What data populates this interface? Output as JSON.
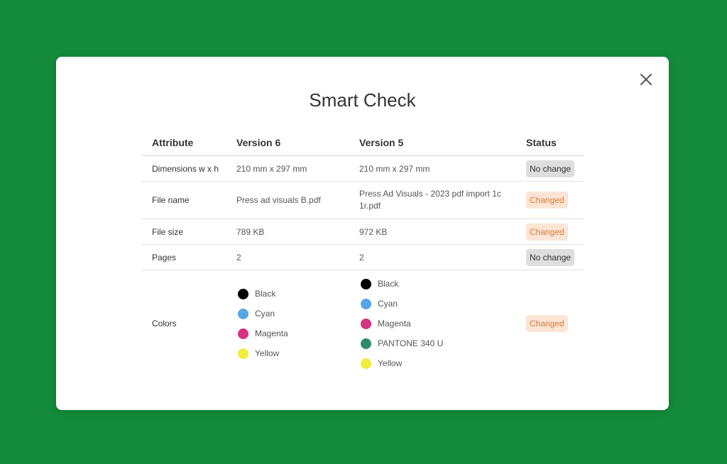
{
  "dialog": {
    "title": "Smart Check",
    "close_label": "Close"
  },
  "table": {
    "headers": [
      "Attribute",
      "Version 6",
      "Version 5",
      "Status"
    ],
    "rows": [
      {
        "attribute": "Dimensions w x h",
        "v6": "210 mm x 297 mm",
        "v5": "210 mm x 297 mm",
        "status": "No change"
      },
      {
        "attribute": "File name",
        "v6": "Press ad visuals B.pdf",
        "v5": "Press Ad Visuals - 2023 pdf import 1c 1r.pdf",
        "status": "Changed"
      },
      {
        "attribute": "File size",
        "v6": "789 KB",
        "v5": "972 KB",
        "status": "Changed"
      },
      {
        "attribute": "Pages",
        "v6": "2",
        "v5": "2",
        "status": "No change"
      },
      {
        "attribute": "Colors",
        "status": "Changed"
      }
    ],
    "colors_v6": [
      {
        "name": "Black",
        "color": "#000000"
      },
      {
        "name": "Cyan",
        "color": "#56a5e6"
      },
      {
        "name": "Magenta",
        "color": "#d6327f"
      },
      {
        "name": "Yellow",
        "color": "#f2ec3c"
      }
    ],
    "colors_v5": [
      {
        "name": "Black",
        "color": "#000000"
      },
      {
        "name": "Cyan",
        "color": "#56a5e6"
      },
      {
        "name": "Magenta",
        "color": "#d6327f"
      },
      {
        "name": "PANTONE 340 U",
        "color": "#2e8c66"
      },
      {
        "name": "Yellow",
        "color": "#f2ec3c"
      }
    ]
  },
  "colors": {
    "background": "#138b3a",
    "nochange_badge_bg": "#dedede",
    "changed_badge_bg": "#fde5d6",
    "changed_badge_text": "#d77a3b"
  }
}
